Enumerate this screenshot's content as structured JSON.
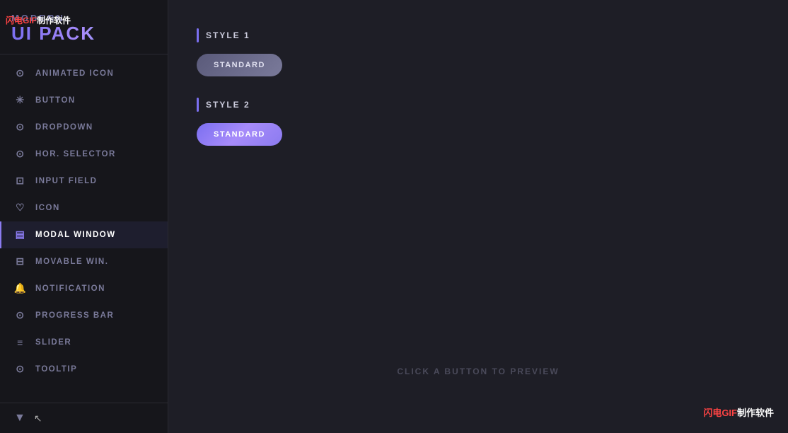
{
  "watermark_top_left": "闪电GIF制作软件",
  "watermark_bottom_right": "闪电GIF制作软件",
  "sidebar": {
    "logo_modern": "MODERN",
    "logo_ui_pack": "UI PACK",
    "nav_items": [
      {
        "id": "animated-icon",
        "label": "ANIMATED ICON",
        "icon": "⊙",
        "active": false
      },
      {
        "id": "button",
        "label": "BUTTON",
        "icon": "✳",
        "active": false
      },
      {
        "id": "dropdown",
        "label": "DROPDOWN",
        "icon": "⊙",
        "active": false
      },
      {
        "id": "hor-selector",
        "label": "HOR. SELECTOR",
        "icon": "⊙",
        "active": false
      },
      {
        "id": "input-field",
        "label": "INPUT FIELD",
        "icon": "⊡",
        "active": false
      },
      {
        "id": "icon",
        "label": "ICON",
        "icon": "♡",
        "active": false
      },
      {
        "id": "modal-window",
        "label": "MODAL WINDOW",
        "icon": "▤",
        "active": true
      },
      {
        "id": "movable-win",
        "label": "MOVABLE WIN.",
        "icon": "⊟",
        "active": false
      },
      {
        "id": "notification",
        "label": "NOTIFICATION",
        "icon": "🔔",
        "active": false
      },
      {
        "id": "progress-bar",
        "label": "PROGRESS BAR",
        "icon": "⊙",
        "active": false
      },
      {
        "id": "slider",
        "label": "SLIDER",
        "icon": "≡",
        "active": false
      },
      {
        "id": "tooltip",
        "label": "TOOLTIP",
        "icon": "⊙",
        "active": false
      }
    ],
    "chevron_label": "▼",
    "cursor_label": "↖"
  },
  "main": {
    "style1": {
      "title": "STYLE 1",
      "button_label": "STANDARD"
    },
    "style2": {
      "title": "STYLE 2",
      "button_label": "STANDARD"
    },
    "preview_text": "CLICK A BUTTON TO PREVIEW"
  }
}
